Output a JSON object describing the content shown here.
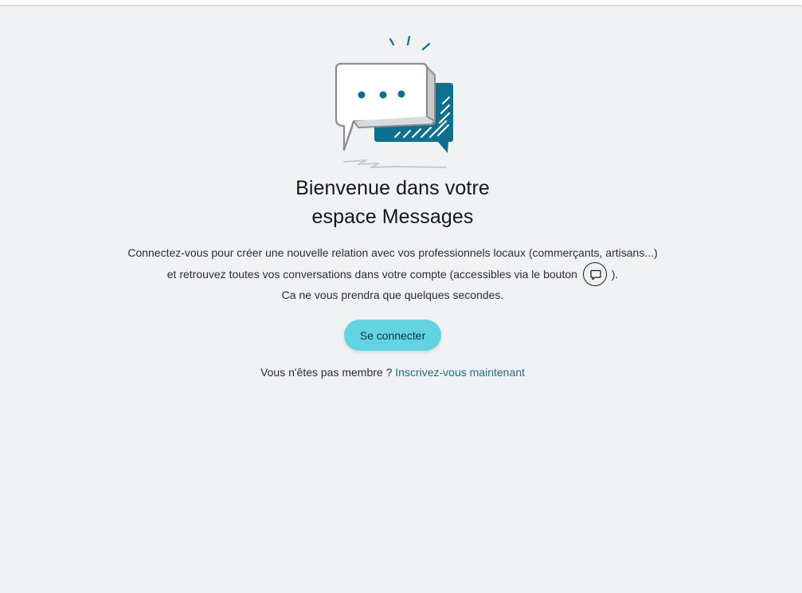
{
  "welcome": {
    "title_line1": "Bienvenue dans votre",
    "title_line2": "espace Messages"
  },
  "description": {
    "line1": "Connectez-vous pour créer une nouvelle relation avec vos professionnels locaux (commerçants, artisans...)",
    "line2_before": "et retrouvez toutes vos conversations dans votre compte (accessibles via le bouton",
    "line2_after": ").",
    "line3": "Ca ne vous prendra que quelques secondes."
  },
  "actions": {
    "connect_label": "Se connecter",
    "signup_prompt": "Vous n'êtes pas membre ?",
    "signup_link": "Inscrivez-vous maintenant"
  },
  "icons": {
    "illustration": "chat-bubbles-icon",
    "inline_button": "message-icon"
  },
  "colors": {
    "background": "#f1f2f4",
    "accent_button": "#62d3e0",
    "link": "#1f6c86",
    "illustration_teal": "#0e6f8f"
  }
}
